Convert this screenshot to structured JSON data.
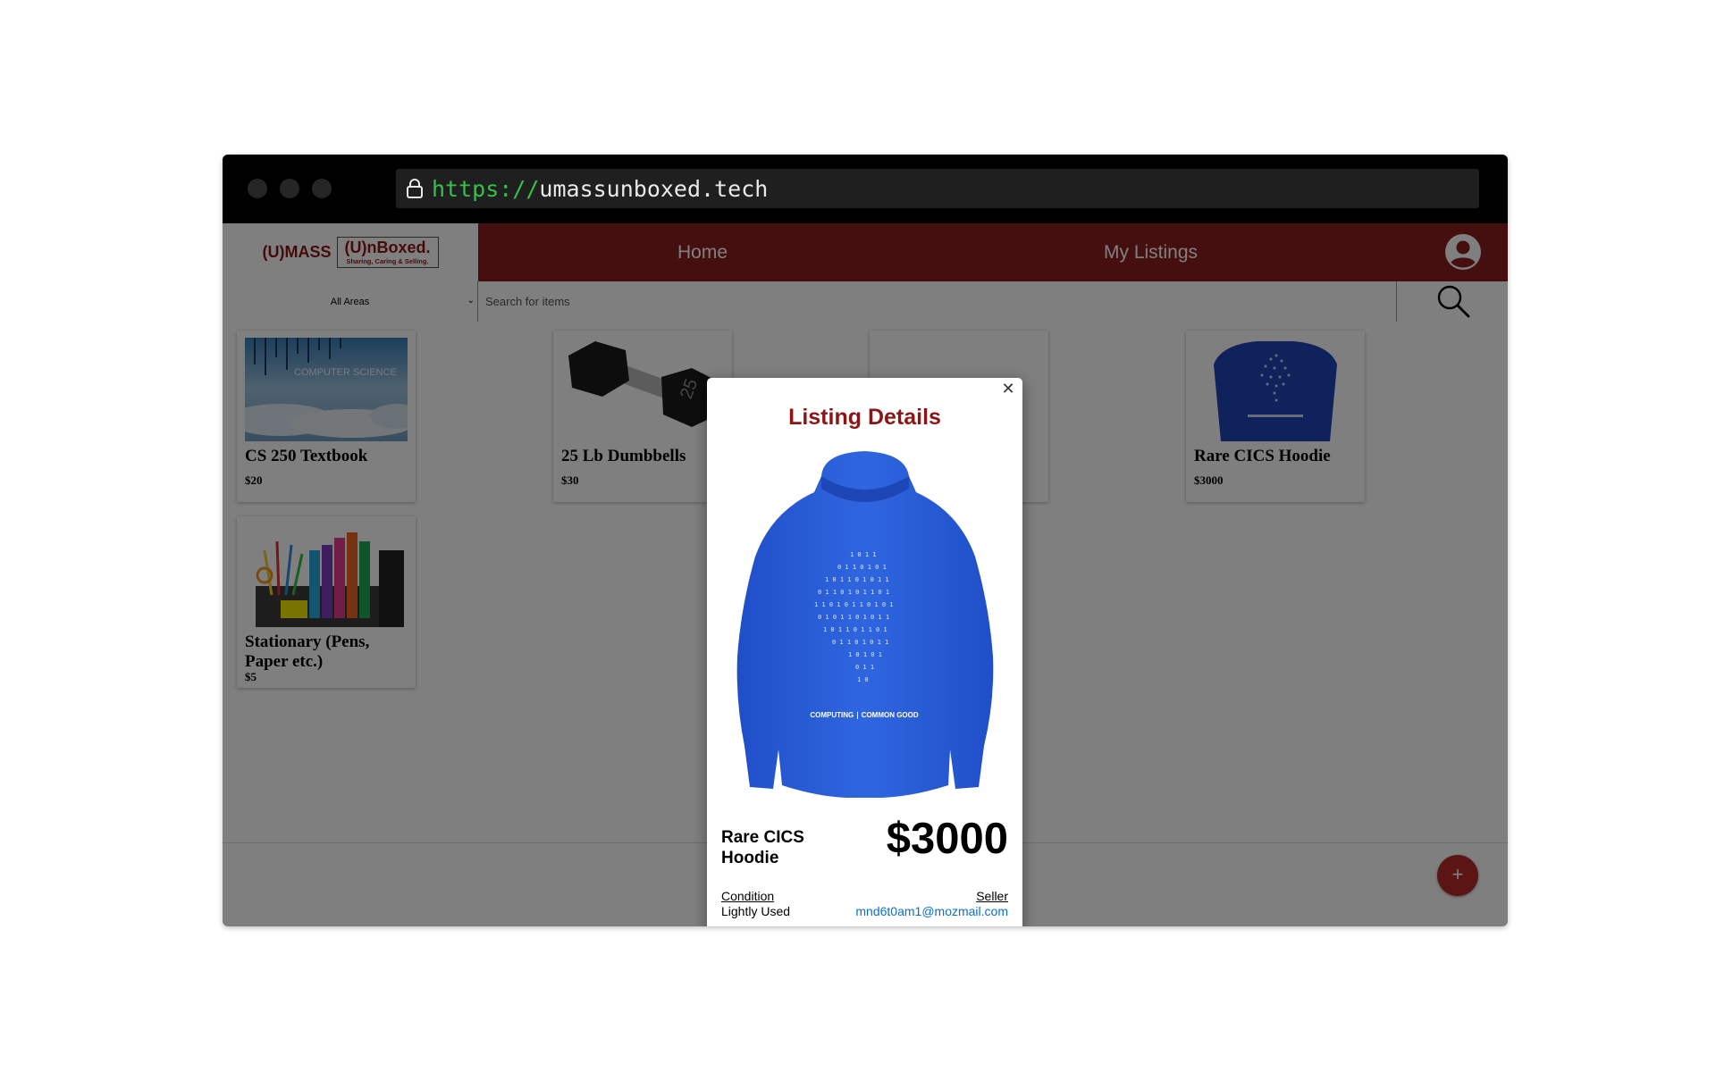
{
  "browser": {
    "url_scheme": "https://",
    "url_host": "umassunboxed.tech"
  },
  "logo": {
    "prefix": "(U)MASS",
    "title": "(U)nBoxed.",
    "tagline": "Sharing, Caring & Selling."
  },
  "nav": {
    "home": "Home",
    "my_listings": "My Listings"
  },
  "search": {
    "area": "All Areas",
    "placeholder": "Search for items"
  },
  "listings": [
    {
      "title": "CS 250 Textbook",
      "price": "$20",
      "image_text": "COMPUTER SCIENCE"
    },
    {
      "title": "25 Lb Dumbbells",
      "price": "$30"
    },
    {
      "title": "Rare CICS Hoodie",
      "price": "$3000"
    },
    {
      "title": "Stationary (Pens, Paper etc.)",
      "price": "$5"
    }
  ],
  "fab_label": "+",
  "modal": {
    "title": "Listing Details",
    "item_name": "Rare CICS Hoodie",
    "price": "$3000",
    "condition_label": "Condition",
    "condition_value": "Lightly Used",
    "seller_label": "Seller",
    "seller_email": "mnd6t0am1@mozmail.com",
    "hoodie_print": "COMPUTING ∣ COMMON GOOD",
    "close_symbol": "✕"
  },
  "colors": {
    "brand_red": "#8b1f1f",
    "title_red": "#8c1515",
    "hoodie_blue": "#2b5fd6",
    "link_blue": "#0a6fc9"
  }
}
